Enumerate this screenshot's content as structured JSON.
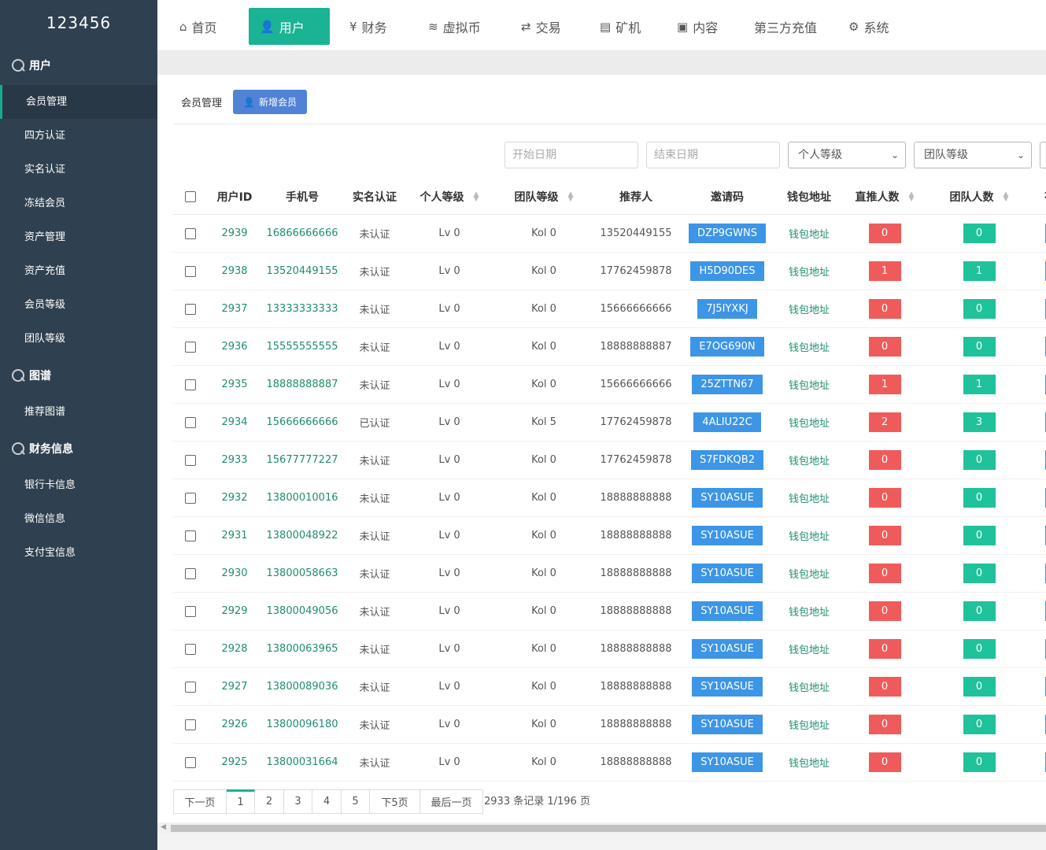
{
  "app": {
    "brand": "123456"
  },
  "topnav": [
    {
      "label": "首页",
      "icon": "home-icon",
      "glyph": "⌂",
      "active": false
    },
    {
      "label": "用户",
      "icon": "user-icon",
      "glyph": "👤",
      "active": true
    },
    {
      "label": "财务",
      "icon": "yen-icon",
      "glyph": "¥",
      "active": false
    },
    {
      "label": "虚拟币",
      "icon": "database-icon",
      "glyph": "≋",
      "active": false
    },
    {
      "label": "交易",
      "icon": "exchange-icon",
      "glyph": "⇄",
      "active": false
    },
    {
      "label": "矿机",
      "icon": "server-icon",
      "glyph": "▤",
      "active": false
    },
    {
      "label": "内容",
      "icon": "document-icon",
      "glyph": "▣",
      "active": false
    },
    {
      "label": "第三方充值",
      "icon": "",
      "glyph": "",
      "active": false
    },
    {
      "label": "系统",
      "icon": "gear-icon",
      "glyph": "⚙",
      "active": false
    }
  ],
  "sidebar": {
    "groups": [
      {
        "title": "用户",
        "items": [
          {
            "label": "会员管理",
            "active": true
          },
          {
            "label": "四方认证"
          },
          {
            "label": "实名认证"
          },
          {
            "label": "冻结会员"
          },
          {
            "label": "资产管理"
          },
          {
            "label": "资产充值"
          },
          {
            "label": "会员等级"
          },
          {
            "label": "团队等级"
          }
        ]
      },
      {
        "title": "图谱",
        "items": [
          {
            "label": "推荐图谱"
          }
        ]
      },
      {
        "title": "财务信息",
        "items": [
          {
            "label": "银行卡信息"
          },
          {
            "label": "微信信息"
          },
          {
            "label": "支付宝信息"
          }
        ]
      }
    ]
  },
  "toolbar": {
    "breadcrumb": "会员管理",
    "add_label": "新增会员"
  },
  "filters": {
    "start_placeholder": "开始日期",
    "end_placeholder": "结束日期",
    "personal_level": "个人等级",
    "team_level": "团队等级"
  },
  "table": {
    "headers": [
      "用户ID",
      "手机号",
      "实名认证",
      "个人等级",
      "团队等级",
      "推荐人",
      "邀请码",
      "钱包地址",
      "直推人数",
      "团队人数",
      "有"
    ],
    "rows": [
      {
        "id": "2939",
        "phone": "16866666666",
        "verify": "未认证",
        "level": "Lv 0",
        "team": "Kol 0",
        "referrer": "13520449155",
        "code": "DZP9GWNS",
        "wallet": "钱包地址",
        "direct": "0",
        "teamcount": "0"
      },
      {
        "id": "2938",
        "phone": "13520449155",
        "verify": "未认证",
        "level": "Lv 0",
        "team": "Kol 0",
        "referrer": "17762459878",
        "code": "H5D90DES",
        "wallet": "钱包地址",
        "direct": "1",
        "teamcount": "1"
      },
      {
        "id": "2937",
        "phone": "13333333333",
        "verify": "未认证",
        "level": "Lv 0",
        "team": "Kol 0",
        "referrer": "15666666666",
        "code": "7J5IYXKJ",
        "wallet": "钱包地址",
        "direct": "0",
        "teamcount": "0"
      },
      {
        "id": "2936",
        "phone": "15555555555",
        "verify": "未认证",
        "level": "Lv 0",
        "team": "Kol 0",
        "referrer": "18888888887",
        "code": "E7OG690N",
        "wallet": "钱包地址",
        "direct": "0",
        "teamcount": "0"
      },
      {
        "id": "2935",
        "phone": "18888888887",
        "verify": "未认证",
        "level": "Lv 0",
        "team": "Kol 0",
        "referrer": "15666666666",
        "code": "25ZTTN67",
        "wallet": "钱包地址",
        "direct": "1",
        "teamcount": "1"
      },
      {
        "id": "2934",
        "phone": "15666666666",
        "verify": "已认证",
        "level": "Lv 0",
        "team": "Kol 5",
        "referrer": "17762459878",
        "code": "4ALIU22C",
        "wallet": "钱包地址",
        "direct": "2",
        "teamcount": "3"
      },
      {
        "id": "2933",
        "phone": "15677777227",
        "verify": "未认证",
        "level": "Lv 0",
        "team": "Kol 0",
        "referrer": "17762459878",
        "code": "S7FDKQB2",
        "wallet": "钱包地址",
        "direct": "0",
        "teamcount": "0"
      },
      {
        "id": "2932",
        "phone": "13800010016",
        "verify": "未认证",
        "level": "Lv 0",
        "team": "Kol 0",
        "referrer": "18888888888",
        "code": "SY10ASUE",
        "wallet": "钱包地址",
        "direct": "0",
        "teamcount": "0"
      },
      {
        "id": "2931",
        "phone": "13800048922",
        "verify": "未认证",
        "level": "Lv 0",
        "team": "Kol 0",
        "referrer": "18888888888",
        "code": "SY10ASUE",
        "wallet": "钱包地址",
        "direct": "0",
        "teamcount": "0"
      },
      {
        "id": "2930",
        "phone": "13800058663",
        "verify": "未认证",
        "level": "Lv 0",
        "team": "Kol 0",
        "referrer": "18888888888",
        "code": "SY10ASUE",
        "wallet": "钱包地址",
        "direct": "0",
        "teamcount": "0"
      },
      {
        "id": "2929",
        "phone": "13800049056",
        "verify": "未认证",
        "level": "Lv 0",
        "team": "Kol 0",
        "referrer": "18888888888",
        "code": "SY10ASUE",
        "wallet": "钱包地址",
        "direct": "0",
        "teamcount": "0"
      },
      {
        "id": "2928",
        "phone": "13800063965",
        "verify": "未认证",
        "level": "Lv 0",
        "team": "Kol 0",
        "referrer": "18888888888",
        "code": "SY10ASUE",
        "wallet": "钱包地址",
        "direct": "0",
        "teamcount": "0"
      },
      {
        "id": "2927",
        "phone": "13800089036",
        "verify": "未认证",
        "level": "Lv 0",
        "team": "Kol 0",
        "referrer": "18888888888",
        "code": "SY10ASUE",
        "wallet": "钱包地址",
        "direct": "0",
        "teamcount": "0"
      },
      {
        "id": "2926",
        "phone": "13800096180",
        "verify": "未认证",
        "level": "Lv 0",
        "team": "Kol 0",
        "referrer": "18888888888",
        "code": "SY10ASUE",
        "wallet": "钱包地址",
        "direct": "0",
        "teamcount": "0"
      },
      {
        "id": "2925",
        "phone": "13800031664",
        "verify": "未认证",
        "level": "Lv 0",
        "team": "Kol 0",
        "referrer": "18888888888",
        "code": "SY10ASUE",
        "wallet": "钱包地址",
        "direct": "0",
        "teamcount": "0"
      }
    ]
  },
  "pagination": {
    "buttons": [
      "下一页",
      "1",
      "2",
      "3",
      "4",
      "5",
      "下5页",
      "最后一页"
    ],
    "current": "1",
    "info": "2933 条记录 1/196 页"
  },
  "colors": {
    "sidebar": "#2f4050",
    "accent": "#1ab394",
    "code": "#3d95e6",
    "red_badge": "#ef5b5b",
    "green_badge": "#1fc29a",
    "add_button": "#5182d6"
  }
}
